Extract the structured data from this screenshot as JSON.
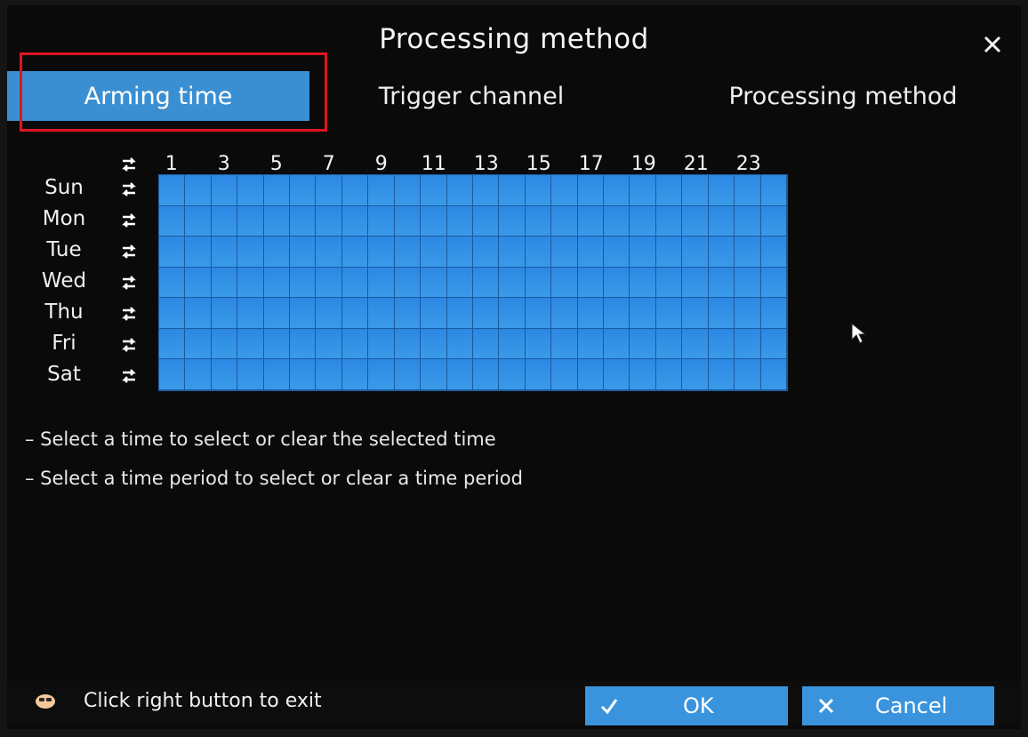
{
  "dialog": {
    "title": "Processing method",
    "close_icon": "close-icon"
  },
  "tabs": [
    {
      "label": "Arming time",
      "active": true
    },
    {
      "label": "Trigger channel",
      "active": false
    },
    {
      "label": "Processing method",
      "active": false
    }
  ],
  "schedule": {
    "hour_labels": [
      "1",
      "3",
      "5",
      "7",
      "9",
      "11",
      "13",
      "15",
      "17",
      "19",
      "21",
      "23"
    ],
    "days": [
      "Sun",
      "Mon",
      "Tue",
      "Wed",
      "Thu",
      "Fri",
      "Sat"
    ],
    "hours_per_day": 24,
    "all_selected": true,
    "cell_color": "#2f84da"
  },
  "hints": [
    "– Select a time to select or clear the selected time",
    "– Select a time period to select or clear a time period"
  ],
  "footer": {
    "exit_hint": "Click right button to exit",
    "ok_label": "OK",
    "cancel_label": "Cancel"
  },
  "colors": {
    "accent": "#3a8fd2",
    "highlight": "#e0141d",
    "background": "#0a0a0a"
  }
}
